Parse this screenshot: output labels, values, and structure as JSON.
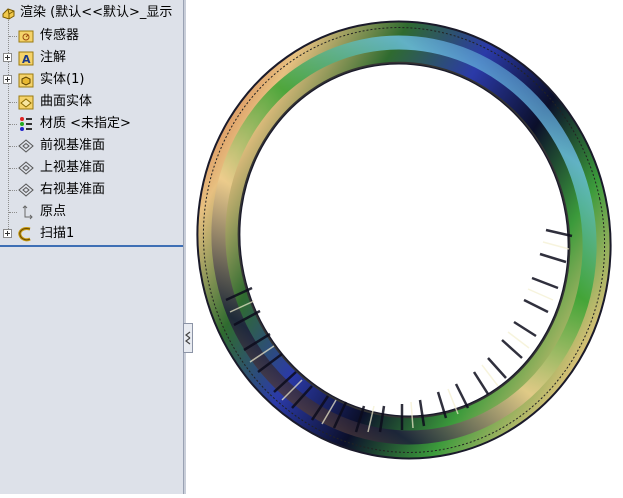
{
  "tree": {
    "root": {
      "label": "渲染 (默认<<默认>_显示",
      "icon": "part-icon"
    },
    "items": [
      {
        "label": "传感器",
        "icon": "sensor-folder-icon"
      },
      {
        "label": "注解",
        "icon": "annotation-folder-icon"
      },
      {
        "label": "实体(1)",
        "icon": "solid-bodies-folder-icon"
      },
      {
        "label": "曲面实体",
        "icon": "surface-bodies-folder-icon"
      },
      {
        "label": "材质 <未指定>",
        "icon": "material-icon"
      },
      {
        "label": "前视基准面",
        "icon": "plane-icon"
      },
      {
        "label": "上视基准面",
        "icon": "plane-icon"
      },
      {
        "label": "右视基准面",
        "icon": "plane-icon"
      },
      {
        "label": "原点",
        "icon": "origin-icon"
      },
      {
        "label": "扫描1",
        "icon": "sweep-feature-icon"
      }
    ]
  },
  "colors": {
    "panel_bg": "#dde1e9",
    "rollback_bar": "#3e6fb5",
    "viewport_bg": "#ffffff"
  }
}
